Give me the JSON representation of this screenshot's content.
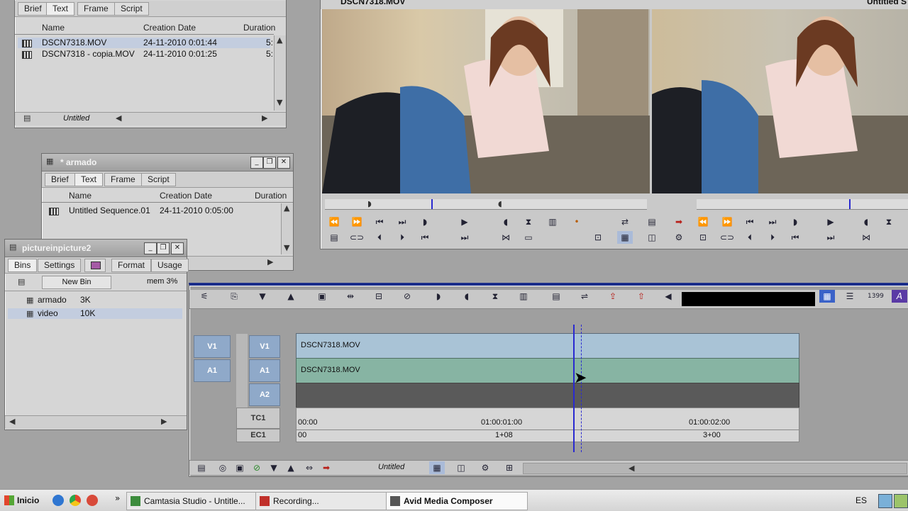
{
  "bin1": {
    "tabs": [
      "Brief",
      "Text",
      "Frame",
      "Script"
    ],
    "active_tab": "Text",
    "columns": [
      "Name",
      "Creation Date",
      "Duration"
    ],
    "rows": [
      {
        "name": "DSCN7318.MOV",
        "date": "24-11-2010 0:01:44",
        "duration": "5:"
      },
      {
        "name": "DSCN7318 - copia.MOV",
        "date": "24-11-2010 0:01:25",
        "duration": "5:"
      }
    ],
    "footer_label": "Untitled"
  },
  "bin2": {
    "title": "* armado",
    "tabs": [
      "Brief",
      "Text",
      "Frame",
      "Script"
    ],
    "columns": [
      "Name",
      "Creation Date",
      "Duration"
    ],
    "rows": [
      {
        "name": "Untitled Sequence.01",
        "date": "24-11-2010 0:05:00",
        "duration": ""
      }
    ]
  },
  "project": {
    "title": "pictureinpicture2",
    "tabs": [
      "Bins",
      "Settings",
      "",
      "Format",
      "Usage"
    ],
    "new_bin_label": "New Bin",
    "memory": "mem 3%",
    "bins": [
      {
        "name": "armado",
        "size": "3K"
      },
      {
        "name": "video",
        "size": "10K"
      }
    ]
  },
  "composer": {
    "source_title": "DSCN7318.MOV",
    "record_title": "Untitled S"
  },
  "timeline": {
    "tracks": [
      {
        "patch": "V1",
        "name": "V1",
        "clip": "DSCN7318.MOV"
      },
      {
        "patch": "A1",
        "name": "A1",
        "clip": "DSCN7318.MOV"
      },
      {
        "patch": "",
        "name": "A2",
        "clip": ""
      }
    ],
    "tc_label": "TC1",
    "ec_label": "EC1",
    "tc_marks": [
      "00:00",
      "01:00:01:00",
      "01:00:02:00"
    ],
    "ec_marks": [
      "00",
      "1+08",
      "3+00"
    ],
    "footer_label": "Untitled"
  },
  "taskbar": {
    "start": "Inicio",
    "buttons": [
      "Camtasia Studio - Untitle...",
      "Recording...",
      "Avid Media Composer"
    ],
    "lang": "ES"
  },
  "colors": {
    "desktop": "#a3a3a3",
    "selection": "#c3cddf",
    "v1_track": "#a9c3d6",
    "a1_track": "#87b4a3",
    "playhead": "#2a2ad0"
  }
}
